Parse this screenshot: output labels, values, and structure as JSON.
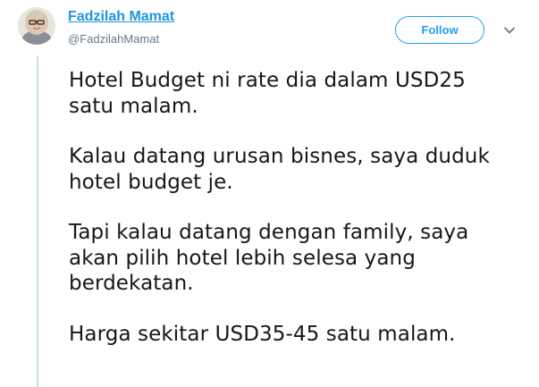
{
  "tweet": {
    "author": {
      "name": "Fadzilah Mamat",
      "handle": "@FadzilahMamat"
    },
    "follow_label": "Follow",
    "paragraphs": [
      [
        "Hotel Budget ni rate dia dalam USD25",
        "satu malam."
      ],
      [
        "Kalau datang urusan bisnes, saya duduk",
        "hotel budget je."
      ],
      [
        "Tapi kalau datang dengan family, saya",
        "akan pilih hotel lebih selesa yang",
        "berdekatan."
      ],
      [
        "Harga sekitar USD35-45 satu malam."
      ]
    ]
  },
  "icons": {
    "avatar": "profile-photo",
    "menu": "chevron-down-icon"
  },
  "colors": {
    "link": "#1b95e0",
    "accent": "#1da1f2",
    "handle": "#657786",
    "text": "#14171a",
    "thread_line": "#c4e1f6"
  }
}
